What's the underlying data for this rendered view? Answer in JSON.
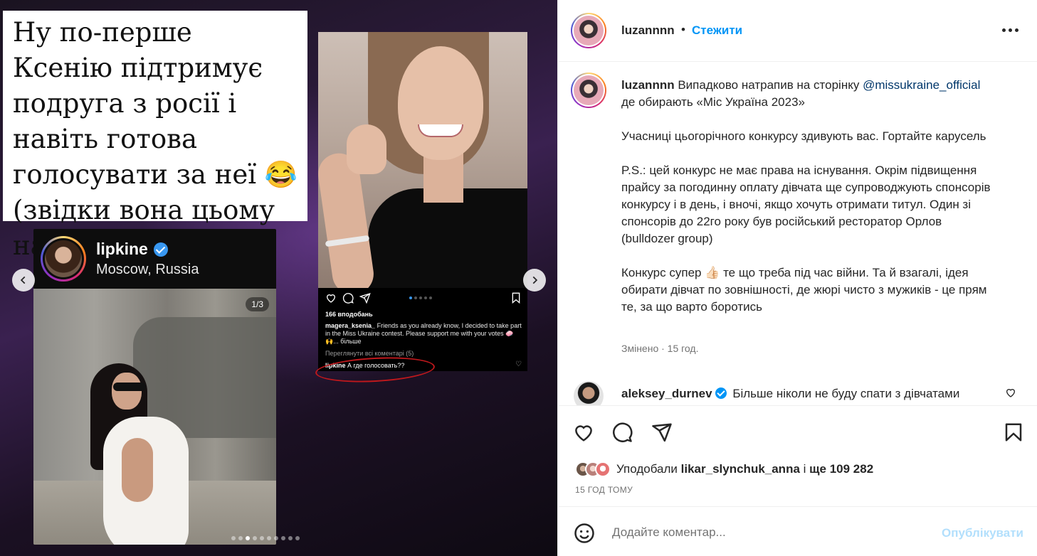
{
  "media": {
    "caption_text": "Ну по-перше Ксенію підтримує подруга з росії і навіть готова голосувати за неї 😂 (звідки вона цьому навчилась в рфіі)",
    "story": {
      "username": "lipkine",
      "location": "Moscow, Russia",
      "counter": "1/3"
    },
    "ksenia_post": {
      "likes": "166 вподобань",
      "caption_user": "magera_ksenia_",
      "caption_text": "Friends as you already know, I decided to take part in the Miss Ukraine contest. Please support me with your votes 🧼🙌... більше",
      "view_all": "Переглянути всі коментарі (5)",
      "comment_user": "lipkine",
      "comment_text": "А где голосовать??"
    },
    "carousel_dots_count": 10,
    "carousel_active_index": 2
  },
  "header": {
    "username": "luzannnn",
    "separator": "•",
    "follow_label": "Стежити"
  },
  "caption": {
    "username": "luzannnn",
    "line1_rest": "Випадково натрапив на сторінку",
    "mention": "@missukraine_official",
    "line2_rest": "де обирають «Міс Україна 2023»",
    "para2": "Учасниці цьогорічного конкурсу здивують вас. Гортайте карусель",
    "para3": "P.S.: цей конкурс не має права на існування. Окрім підвищення прайсу за погодинну оплату дівчата ще супроводжують спонсорів конкурсу і в день, і вночі, якщо хочуть отримати титул. Один зі спонсорів до 22го року був російський ресторатор Орлов (bulldozer group)",
    "para4": "Конкурс супер 👍🏻 те що треба під час війни. Та й взагалі, ідея обирати дівчат по зовнішності, де жюрі чисто з мужиків - це прям те, за що варто боротись",
    "meta": "Змінено · 15 год."
  },
  "comment": {
    "username": "aleksey_durnev",
    "text": "Більше ніколи не буду спати з дівчатами"
  },
  "actions": {
    "liked_prefix": "Уподобали",
    "liked_user": "likar_slynchuk_anna",
    "liked_mid": "і",
    "liked_count": "ще 109 282",
    "time_ago": "15 ГОД ТОМУ"
  },
  "add_comment": {
    "placeholder": "Додайте коментар...",
    "publish_label": "Опублікувати"
  },
  "colors": {
    "accent": "#0095f6",
    "text": "#262626",
    "muted": "#737373",
    "mention": "#00376b",
    "publish_disabled": "#b2dffc",
    "highlight_circle": "#c0181c"
  }
}
